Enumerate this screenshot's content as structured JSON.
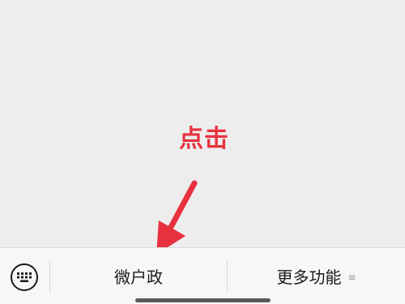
{
  "annotation": {
    "text": "点击",
    "color": "#e8313f"
  },
  "bottom_bar": {
    "keyboard_icon": "keyboard-icon",
    "menu_items": [
      {
        "label": "微户政"
      },
      {
        "label": "更多功能",
        "indicator": "≡"
      }
    ]
  },
  "colors": {
    "background": "#ededed",
    "bar_background": "#f7f7f7",
    "accent": "#e8313f"
  }
}
